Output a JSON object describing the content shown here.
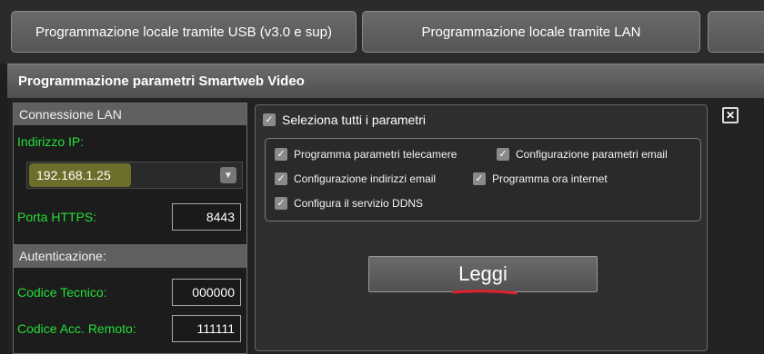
{
  "tabs": [
    {
      "label": "Programmazione locale tramite USB (v3.0 e sup)"
    },
    {
      "label": "Programmazione locale tramite LAN"
    },
    {
      "label": ""
    }
  ],
  "section_title": "Programmazione parametri Smartweb Video",
  "lan": {
    "header": "Connessione LAN",
    "ip_label": "Indirizzo IP:",
    "ip_value": "192.168.1.25",
    "port_label": "Porta HTTPS:",
    "port_value": "8443"
  },
  "auth": {
    "header": "Autenticazione:",
    "tech_code_label": "Codice Tecnico:",
    "tech_code_value": "000000",
    "remote_code_label": "Codice Acc. Remoto:",
    "remote_code_value": "111111"
  },
  "params": {
    "select_all": "Seleziona tutti i parametri",
    "items": [
      "Programma parametri telecamere",
      "Configurazione parametri email",
      "Configurazione indirizzi email",
      "Programma ora internet",
      "Configura il servizio DDNS"
    ]
  },
  "read_button": "Leggi",
  "colors": {
    "label_green": "#24e03a",
    "highlight_yellow": "#ffff33",
    "underline_red": "#e0202a"
  }
}
